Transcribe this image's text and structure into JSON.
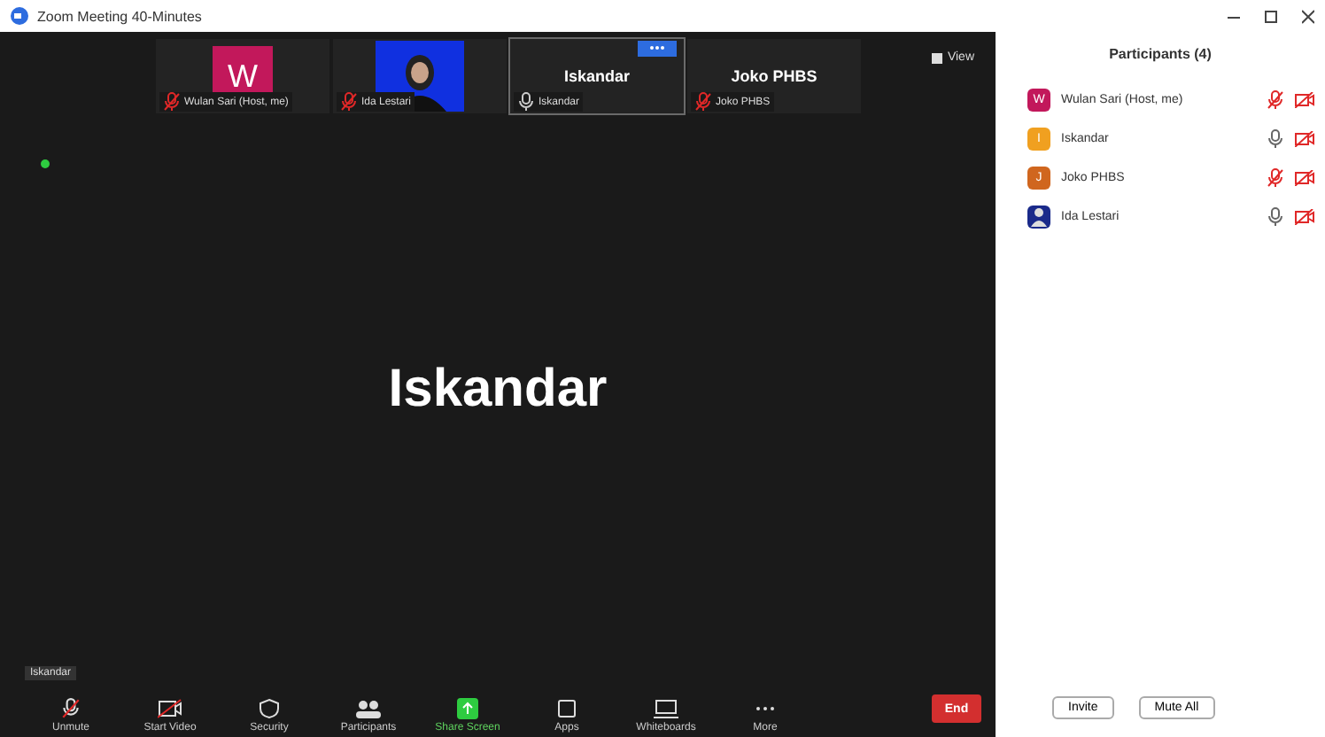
{
  "window": {
    "title": "Zoom Meeting 40-Minutes"
  },
  "tiles": [
    {
      "kind": "initial",
      "initial": "W",
      "color": "#c2185b",
      "name": "Wulan Sari (Host, me)",
      "mic_muted": true,
      "active": false
    },
    {
      "kind": "picture",
      "name": "Ida Lestari",
      "mic_muted": true,
      "active": false
    },
    {
      "kind": "name",
      "label": "Iskandar",
      "name": "Iskandar",
      "mic_muted": false,
      "active": true
    },
    {
      "kind": "name",
      "label": "Joko PHBS",
      "name": "Joko PHBS",
      "mic_muted": true,
      "active": false
    }
  ],
  "view_button": "View",
  "speaker": {
    "name": "Iskandar"
  },
  "speaking_label": "Iskandar",
  "toolbar": [
    {
      "kind": "mic",
      "label": "Unmute"
    },
    {
      "kind": "video",
      "label": "Start Video"
    },
    {
      "kind": "shield",
      "label": "Security"
    },
    {
      "kind": "people",
      "label": "Participants"
    },
    {
      "kind": "share",
      "label": "Share Screen"
    },
    {
      "kind": "apps",
      "label": "Apps"
    },
    {
      "kind": "board",
      "label": "Whiteboards"
    },
    {
      "kind": "more",
      "label": "More"
    }
  ],
  "end_button": "End",
  "panel": {
    "title": "Participants (4)",
    "participants": [
      {
        "initial": "W",
        "color": "#c2185b",
        "name": "Wulan Sari (Host, me)",
        "mic_muted": true,
        "video_off": true
      },
      {
        "initial": "I",
        "color": "#f0a020",
        "name": "Iskandar",
        "mic_muted": false,
        "video_off": true
      },
      {
        "initial": "J",
        "color": "#d0661e",
        "name": "Joko PHBS",
        "mic_muted": true,
        "video_off": true
      },
      {
        "kind": "picture",
        "color": "#1a2a8a",
        "name": "Ida Lestari",
        "mic_muted": false,
        "video_off": true
      }
    ],
    "buttons": [
      "Invite",
      "Mute All"
    ]
  }
}
